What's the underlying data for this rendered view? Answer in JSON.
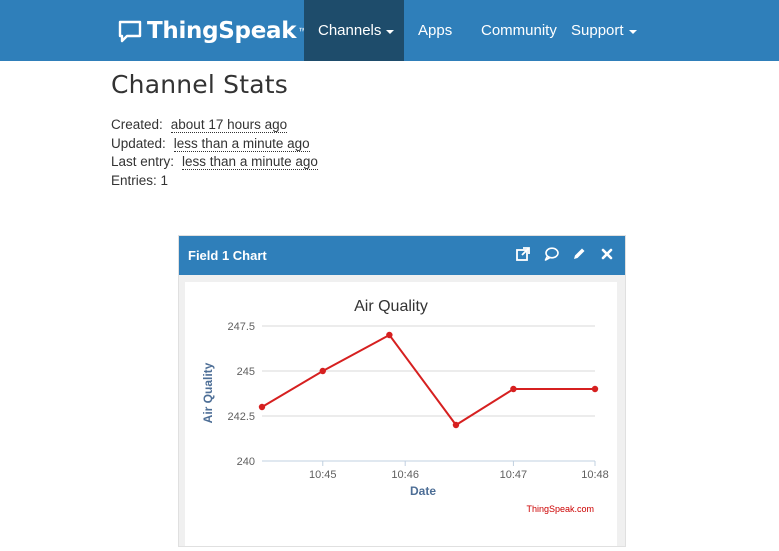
{
  "brand": {
    "name": "ThingSpeak",
    "tm": "™"
  },
  "nav": {
    "channels": "Channels",
    "apps": "Apps",
    "community": "Community",
    "support": "Support"
  },
  "page": {
    "title": "Channel Stats"
  },
  "stats": {
    "created_label": "Created:",
    "created_value": "about 17 hours ago",
    "updated_label": "Updated:",
    "updated_value": "less than a minute ago",
    "last_entry_label": "Last entry:",
    "last_entry_value": "less than a minute ago",
    "entries_label": "Entries:",
    "entries_value": "1"
  },
  "panel": {
    "title": "Field 1 Chart",
    "icons": [
      "external-link-icon",
      "comment-icon",
      "pencil-icon",
      "close-icon"
    ]
  },
  "colors": {
    "navbar": "#2f7fba",
    "nav_active": "#1e4c6b",
    "series": "#d62020",
    "credit": "#cc0000"
  },
  "chart_data": {
    "type": "line",
    "title": "Air Quality",
    "xlabel": "Date",
    "ylabel": "Air Quality",
    "ylim": [
      240,
      247.5
    ],
    "yticks": [
      240,
      242.5,
      245,
      247.5
    ],
    "ytick_labels": [
      "240",
      "242.5",
      "245",
      "247.5"
    ],
    "xticks": [
      "10:45",
      "10:46",
      "10:47",
      "10:48"
    ],
    "x_minutes": [
      44.0,
      44.73,
      45.53,
      46.33,
      47.02,
      48.0
    ],
    "xtick_minutes": [
      44.73,
      45.72,
      47.02,
      48.0
    ],
    "values": [
      243,
      245,
      247,
      242,
      244,
      244
    ],
    "credit": "ThingSpeak.com",
    "grid": true
  }
}
